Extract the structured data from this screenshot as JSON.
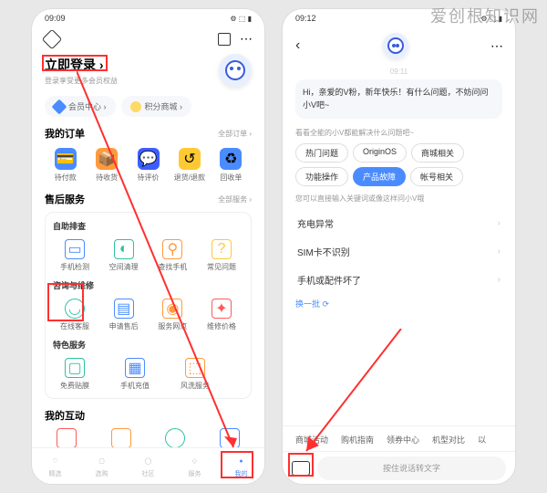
{
  "watermark": "爱创根知识网",
  "left": {
    "status_time": "09:09",
    "status_right": "⚙ ⬚ ▮",
    "login_title": "立即登录 ›",
    "login_sub": "登录享受更多会员权益",
    "pill_member": "会员中心 ›",
    "pill_points": "积分商城 ›",
    "orders_title": "我的订单",
    "orders_link": "全部订单 ›",
    "orders": [
      "待付款",
      "待收货",
      "待评价",
      "退货/退款",
      "回收单"
    ],
    "after_title": "售后服务",
    "after_link": "全部服务 ›",
    "self_title": "自助排查",
    "self": [
      "手机检测",
      "空间清理",
      "查找手机",
      "常见问题"
    ],
    "consult_title": "咨询与维修",
    "consult": [
      "在线客服",
      "申请售后",
      "服务网点",
      "维修价格"
    ],
    "special_title": "特色服务",
    "special": [
      "免费贴膜",
      "手机充值",
      "风洗服务"
    ],
    "interact_title": "我的互动",
    "nav": [
      "精选",
      "选购",
      "社区",
      "服务",
      "我的"
    ]
  },
  "right": {
    "status_time": "09:12",
    "status_right": "⚙ ⬚ ▮",
    "chat_time": "09:11",
    "greeting": "Hi，亲爱的V粉，新年快乐！有什么问题，不妨问问小V吧~",
    "hint1": "看看全能的小V都能解决什么问题吧~",
    "chips": [
      "热门问题",
      "OriginOS",
      "商城相关",
      "功能操作",
      "产品故障",
      "帐号相关"
    ],
    "active_chip_index": 4,
    "hint2": "您可以直接输入关键词或像这样问小V哦",
    "questions": [
      "充电异常",
      "SIM卡不识别",
      "手机或配件坏了"
    ],
    "refresh": "换一批 ⟳",
    "tags": [
      "商城活动",
      "购机指南",
      "领券中心",
      "机型对比",
      "以"
    ],
    "voice_placeholder": "按住说话转文字"
  }
}
